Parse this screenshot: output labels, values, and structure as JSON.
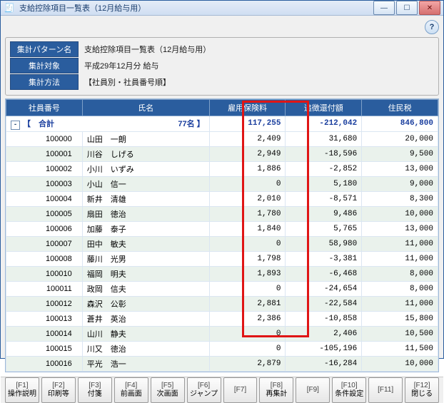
{
  "window": {
    "title": "支給控除項目一覧表（12月給与用）"
  },
  "summary": {
    "k1": "集計パターン名",
    "v1": "支給控除項目一覧表（12月給与用）",
    "k2": "集計対象",
    "v2": "平成29年12月分 給与",
    "k3": "集計方法",
    "v3": "【社員別・社員番号順】"
  },
  "columns": {
    "c1": "社員番号",
    "c2": "氏名",
    "c3": "雇用保険料",
    "c4": "追徴還付額",
    "c5": "住民税"
  },
  "total": {
    "label": "【　合計",
    "count": "77名 】",
    "c3": "117,255",
    "c4": "-212,042",
    "c5": "846,800"
  },
  "rows": [
    {
      "no": "100000",
      "name": "山田　一朗",
      "c3": "2,409",
      "c4": "31,680",
      "c5": "20,000"
    },
    {
      "no": "100001",
      "name": "川谷　しげる",
      "c3": "2,949",
      "c4": "-18,596",
      "c5": "9,500"
    },
    {
      "no": "100002",
      "name": "小川　いずみ",
      "c3": "1,886",
      "c4": "-2,852",
      "c5": "13,000"
    },
    {
      "no": "100003",
      "name": "小山　信一",
      "c3": "0",
      "c4": "5,180",
      "c5": "9,000"
    },
    {
      "no": "100004",
      "name": "新井　清雄",
      "c3": "2,010",
      "c4": "-8,571",
      "c5": "8,300"
    },
    {
      "no": "100005",
      "name": "扇田　徳治",
      "c3": "1,780",
      "c4": "9,486",
      "c5": "10,000"
    },
    {
      "no": "100006",
      "name": "加藤　泰子",
      "c3": "1,840",
      "c4": "5,765",
      "c5": "13,000"
    },
    {
      "no": "100007",
      "name": "田中　敏夫",
      "c3": "0",
      "c4": "58,980",
      "c5": "11,000"
    },
    {
      "no": "100008",
      "name": "藤川　光男",
      "c3": "1,798",
      "c4": "-3,381",
      "c5": "11,000"
    },
    {
      "no": "100010",
      "name": "福岡　明夫",
      "c3": "1,893",
      "c4": "-6,468",
      "c5": "8,000"
    },
    {
      "no": "100011",
      "name": "政岡　信夫",
      "c3": "0",
      "c4": "-24,654",
      "c5": "8,000"
    },
    {
      "no": "100012",
      "name": "森沢　公彰",
      "c3": "2,881",
      "c4": "-22,584",
      "c5": "11,000"
    },
    {
      "no": "100013",
      "name": "蒼井　英治",
      "c3": "2,386",
      "c4": "-10,858",
      "c5": "15,800"
    },
    {
      "no": "100014",
      "name": "山川　静夫",
      "c3": "0",
      "c4": "2,406",
      "c5": "10,500"
    },
    {
      "no": "100015",
      "name": "川又　徳治",
      "c3": "0",
      "c4": "-105,196",
      "c5": "11,500"
    },
    {
      "no": "100016",
      "name": "平光　浩一",
      "c3": "2,879",
      "c4": "-16,284",
      "c5": "10,000"
    }
  ],
  "fkeys": [
    {
      "k": "[F1]",
      "l": "操作説明"
    },
    {
      "k": "[F2]",
      "l": "印刷等"
    },
    {
      "k": "[F3]",
      "l": "付箋"
    },
    {
      "k": "[F4]",
      "l": "前画面"
    },
    {
      "k": "[F5]",
      "l": "次画面"
    },
    {
      "k": "[F6]",
      "l": "ジャンプ"
    },
    {
      "k": "[F7]",
      "l": ""
    },
    {
      "k": "[F8]",
      "l": "再集計"
    },
    {
      "k": "[F9]",
      "l": ""
    },
    {
      "k": "[F10]",
      "l": "条件設定"
    },
    {
      "k": "[F11]",
      "l": ""
    },
    {
      "k": "[F12]",
      "l": "閉じる"
    }
  ]
}
